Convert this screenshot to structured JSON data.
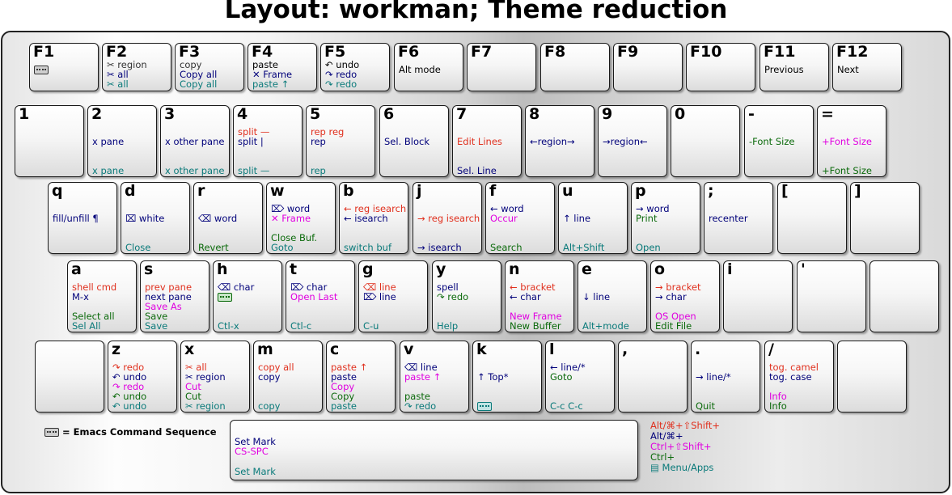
{
  "title": "Layout: workman; Theme reduction",
  "footnote": "= Emacs Command Sequence",
  "legend": [
    {
      "text": "Alt/⌘+⇧Shift+",
      "color": "rd"
    },
    {
      "text": "Alt/⌘+",
      "color": "nv"
    },
    {
      "text": "Ctrl+⇧Shift+",
      "color": "mg"
    },
    {
      "text": "Ctrl+",
      "color": "gr"
    },
    {
      "text": "▤ Menu/Apps",
      "color": "tl"
    }
  ],
  "rows": [
    {
      "keys": [
        {
          "label": "F1",
          "lines": [
            {
              "seq": true
            }
          ]
        },
        {
          "label": "F2",
          "lines": [
            {
              "t": "✂ region",
              "c": "gy"
            },
            {
              "t": "✂ all",
              "c": "nv"
            },
            {
              "t": "✂ all",
              "c": "tl"
            }
          ]
        },
        {
          "label": "F3",
          "lines": [
            {
              "t": "copy",
              "c": "gy"
            },
            {
              "t": "Copy all",
              "c": "nv"
            },
            {
              "t": "Copy all",
              "c": "tl"
            }
          ]
        },
        {
          "label": "F4",
          "lines": [
            {
              "t": "paste",
              "c": "bk"
            },
            {
              "t": "✕ Frame",
              "c": "nv"
            },
            {
              "t": "paste ↑",
              "c": "tl"
            }
          ]
        },
        {
          "label": "F5",
          "lines": [
            {
              "t": "↶ undo",
              "c": "bk"
            },
            {
              "t": "↷ redo",
              "c": "nv"
            },
            {
              "t": "↷ redo",
              "c": "tl"
            }
          ]
        },
        {
          "label": "F6",
          "lines": [
            {
              "t": "Alt mode",
              "c": "bk"
            }
          ]
        },
        {
          "label": "F7",
          "lines": []
        },
        {
          "label": "F8",
          "lines": []
        },
        {
          "label": "F9",
          "lines": []
        },
        {
          "label": "F10",
          "lines": []
        },
        {
          "label": "F11",
          "lines": [
            {
              "t": "Previous",
              "c": "bk"
            }
          ]
        },
        {
          "label": "F12",
          "lines": [
            {
              "t": "Next",
              "c": "bk"
            }
          ]
        }
      ]
    },
    {
      "keys": [
        {
          "label": "1",
          "lines": []
        },
        {
          "label": "2",
          "lines": [
            {
              "t": "x pane",
              "c": "nv"
            },
            {
              "t": "x pane",
              "c": "tl"
            }
          ]
        },
        {
          "label": "3",
          "lines": [
            {
              "t": "x other pane",
              "c": "nv"
            },
            {
              "t": "x other pane",
              "c": "tl"
            }
          ]
        },
        {
          "label": "4",
          "lines": [
            {
              "t": "split —",
              "c": "rd"
            },
            {
              "t": "split |",
              "c": "nv"
            },
            {
              "t": "split —",
              "c": "tl"
            }
          ]
        },
        {
          "label": "5",
          "lines": [
            {
              "t": "rep reg",
              "c": "rd"
            },
            {
              "t": "rep",
              "c": "nv"
            },
            {
              "t": "rep",
              "c": "tl"
            }
          ]
        },
        {
          "label": "6",
          "lines": [
            {
              "t": "Sel. Block",
              "c": "nv"
            }
          ]
        },
        {
          "label": "7",
          "lines": [
            {
              "t": "Edit Lines",
              "c": "rd"
            },
            {
              "t": "Sel. Line",
              "c": "nv"
            }
          ]
        },
        {
          "label": "8",
          "lines": [
            {
              "t": "←region→",
              "c": "nv"
            }
          ]
        },
        {
          "label": "9",
          "lines": [
            {
              "t": "→region←",
              "c": "nv"
            }
          ]
        },
        {
          "label": "0",
          "lines": []
        },
        {
          "label": "-",
          "lines": [
            {
              "t": "-Font Size",
              "c": "gr"
            }
          ]
        },
        {
          "label": "=",
          "lines": [
            {
              "t": "+Font Size",
              "c": "mg"
            },
            {
              "t": "+Font Size",
              "c": "gr"
            }
          ]
        }
      ]
    },
    {
      "keys": [
        {
          "label": "q",
          "lines": [
            {
              "t": "fill/unfill ¶",
              "c": "nv"
            }
          ]
        },
        {
          "label": "d",
          "lines": [
            {
              "t": "⌧ white",
              "c": "nv"
            },
            {
              "t": "Close",
              "c": "tl"
            }
          ]
        },
        {
          "label": "r",
          "lines": [
            {
              "t": "⌫ word",
              "c": "nv"
            },
            {
              "t": "Revert",
              "c": "gr"
            }
          ]
        },
        {
          "label": "w",
          "lines": [
            {
              "t": "⌦ word",
              "c": "nv"
            },
            {
              "t": "✕ Frame",
              "c": "mg"
            },
            {
              "t": "Close Buf.",
              "c": "gr"
            },
            {
              "t": "Goto",
              "c": "tl"
            }
          ]
        },
        {
          "label": "b",
          "lines": [
            {
              "t": "← reg isearch",
              "c": "rd"
            },
            {
              "t": "← isearch",
              "c": "nv"
            },
            {
              "t": "switch buf",
              "c": "tl"
            }
          ]
        },
        {
          "label": "j",
          "lines": [
            {
              "t": "→ reg isearch",
              "c": "rd"
            },
            {
              "t": "→ isearch",
              "c": "nv"
            }
          ]
        },
        {
          "label": "f",
          "lines": [
            {
              "t": "← word",
              "c": "nv"
            },
            {
              "t": "Occur",
              "c": "mg"
            },
            {
              "t": "Search",
              "c": "gr"
            }
          ]
        },
        {
          "label": "u",
          "lines": [
            {
              "t": "↑ line",
              "c": "nv"
            },
            {
              "t": "Alt+Shift",
              "c": "tl"
            }
          ]
        },
        {
          "label": "p",
          "lines": [
            {
              "t": "→ word",
              "c": "nv"
            },
            {
              "t": "Print",
              "c": "gr"
            },
            {
              "t": "Open",
              "c": "tl"
            }
          ]
        },
        {
          "label": ";",
          "lines": [
            {
              "t": "recenter",
              "c": "nv"
            }
          ]
        },
        {
          "label": "[",
          "lines": []
        },
        {
          "label": "]",
          "lines": []
        }
      ]
    },
    {
      "keys": [
        {
          "label": "a",
          "lines": [
            {
              "t": "shell cmd",
              "c": "rd"
            },
            {
              "t": "M-x",
              "c": "nv"
            },
            {
              "t": "Select all",
              "c": "gr"
            },
            {
              "t": "Sel All",
              "c": "tl"
            }
          ]
        },
        {
          "label": "s",
          "lines": [
            {
              "t": "prev pane",
              "c": "rd"
            },
            {
              "t": "next pane",
              "c": "nv"
            },
            {
              "t": "Save As",
              "c": "mg"
            },
            {
              "t": "Save",
              "c": "gr"
            },
            {
              "t": "Save",
              "c": "tl"
            }
          ]
        },
        {
          "label": "h",
          "lines": [
            {
              "t": "⌫ char",
              "c": "nv"
            },
            {
              "seq": true,
              "c": "gr"
            },
            {
              "t": "Ctl-x",
              "c": "tl"
            }
          ]
        },
        {
          "label": "t",
          "lines": [
            {
              "t": "⌦ char",
              "c": "nv"
            },
            {
              "t": "Open Last",
              "c": "mg"
            },
            {
              "t": "Ctl-c",
              "c": "tl"
            }
          ]
        },
        {
          "label": "g",
          "lines": [
            {
              "t": "⌫ line",
              "c": "rd"
            },
            {
              "t": "⌦ line",
              "c": "nv"
            },
            {
              "t": "C-u",
              "c": "tl"
            }
          ]
        },
        {
          "label": "y",
          "lines": [
            {
              "t": "spell",
              "c": "nv"
            },
            {
              "t": "↷ redo",
              "c": "gr"
            },
            {
              "t": "Help",
              "c": "tl"
            }
          ]
        },
        {
          "label": "n",
          "lines": [
            {
              "t": "← bracket",
              "c": "rd"
            },
            {
              "t": "← char",
              "c": "nv"
            },
            {
              "t": "New Frame",
              "c": "mg"
            },
            {
              "t": "New Buffer",
              "c": "gr"
            }
          ]
        },
        {
          "label": "e",
          "lines": [
            {
              "t": "↓ line",
              "c": "nv"
            },
            {
              "t": "Alt+mode",
              "c": "tl"
            }
          ]
        },
        {
          "label": "o",
          "lines": [
            {
              "t": "→ bracket",
              "c": "rd"
            },
            {
              "t": "→ char",
              "c": "nv"
            },
            {
              "t": "OS Open",
              "c": "mg"
            },
            {
              "t": "Edit File",
              "c": "gr"
            }
          ]
        },
        {
          "label": "i",
          "lines": []
        },
        {
          "label": "'",
          "lines": []
        },
        {
          "label": "",
          "lines": []
        }
      ]
    },
    {
      "keys": [
        {
          "label": "",
          "lines": []
        },
        {
          "label": "z",
          "lines": [
            {
              "t": "↷ redo",
              "c": "rd"
            },
            {
              "t": "↶ undo",
              "c": "nv"
            },
            {
              "t": "↷ redo",
              "c": "mg"
            },
            {
              "t": "↶ undo",
              "c": "gr"
            },
            {
              "t": "↶ undo",
              "c": "tl"
            }
          ]
        },
        {
          "label": "x",
          "lines": [
            {
              "t": "✂ all",
              "c": "rd"
            },
            {
              "t": "✂ region",
              "c": "nv"
            },
            {
              "t": "Cut",
              "c": "mg"
            },
            {
              "t": "Cut",
              "c": "gr"
            },
            {
              "t": "✂ region",
              "c": "tl"
            }
          ]
        },
        {
          "label": "m",
          "lines": [
            {
              "t": "copy all",
              "c": "rd"
            },
            {
              "t": "copy",
              "c": "nv"
            },
            {
              "t": "copy",
              "c": "tl"
            }
          ]
        },
        {
          "label": "c",
          "lines": [
            {
              "t": "paste ↑",
              "c": "rd"
            },
            {
              "t": "paste",
              "c": "nv"
            },
            {
              "t": "Copy",
              "c": "mg"
            },
            {
              "t": "Copy",
              "c": "gr"
            },
            {
              "t": "paste",
              "c": "tl"
            }
          ]
        },
        {
          "label": "v",
          "lines": [
            {
              "t": "⌫ line",
              "c": "nv"
            },
            {
              "t": "paste ↑",
              "c": "mg"
            },
            {
              "t": "paste",
              "c": "gr"
            },
            {
              "t": "↷ redo",
              "c": "tl"
            }
          ]
        },
        {
          "label": "k",
          "lines": [
            {
              "t": "↑ Top*",
              "c": "nv"
            },
            {
              "seq": true,
              "c": "tl"
            }
          ]
        },
        {
          "label": "l",
          "lines": [
            {
              "t": "← line/*",
              "c": "nv"
            },
            {
              "t": "Goto",
              "c": "gr"
            },
            {
              "t": "C-c C-c",
              "c": "tl"
            }
          ]
        },
        {
          "label": ",",
          "lines": []
        },
        {
          "label": ".",
          "lines": [
            {
              "t": "→ line/*",
              "c": "nv"
            },
            {
              "t": "Quit",
              "c": "gr"
            }
          ]
        },
        {
          "label": "/",
          "lines": [
            {
              "t": "tog. camel",
              "c": "rd"
            },
            {
              "t": "tog. case",
              "c": "nv"
            },
            {
              "t": "Info",
              "c": "mg"
            },
            {
              "t": "Info",
              "c": "gr"
            }
          ]
        },
        {
          "label": "",
          "lines": []
        }
      ]
    },
    {
      "keys": [
        {
          "label": "",
          "lines": [
            {
              "t": "Set Mark",
              "c": "nv"
            },
            {
              "t": "CS-SPC",
              "c": "mg"
            },
            {
              "t": "Set Mark",
              "c": "tl"
            }
          ]
        }
      ]
    }
  ]
}
